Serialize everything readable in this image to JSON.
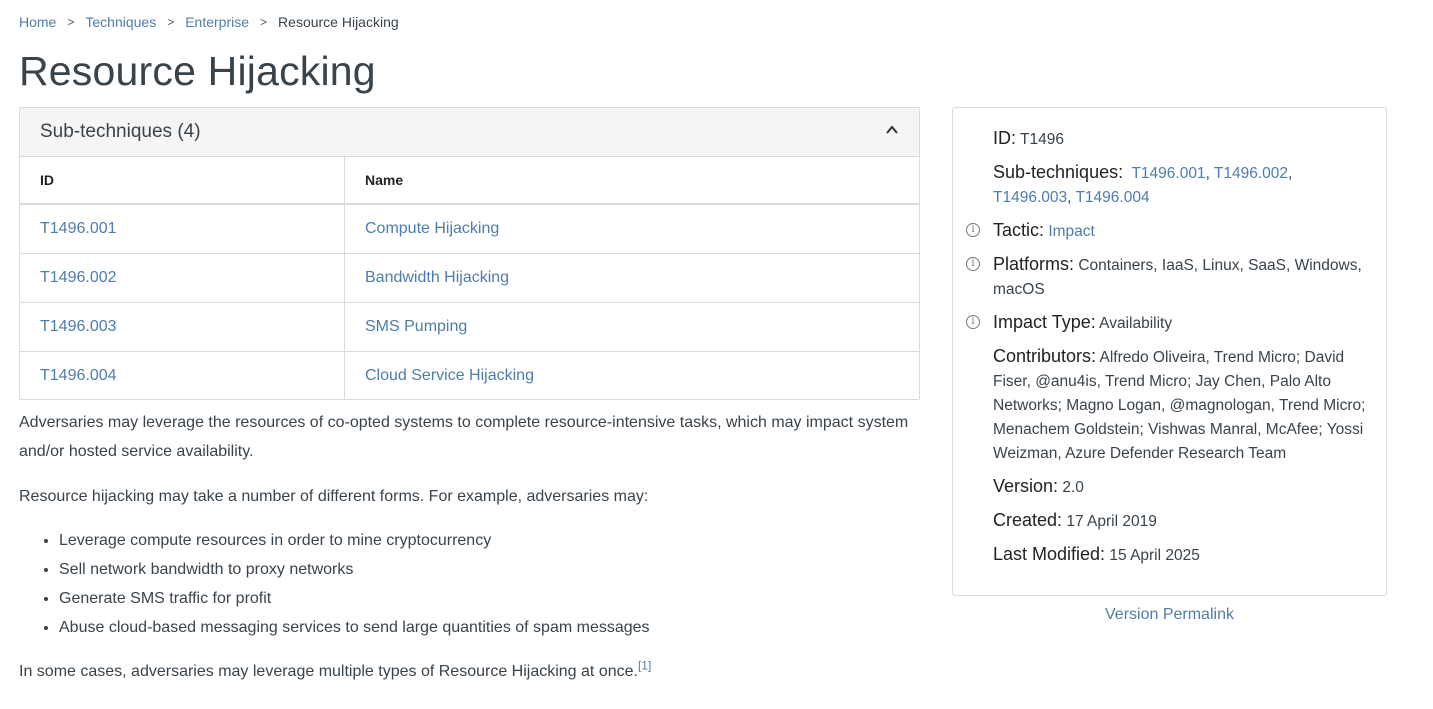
{
  "breadcrumb": {
    "items": [
      {
        "label": "Home"
      },
      {
        "label": "Techniques"
      },
      {
        "label": "Enterprise"
      }
    ],
    "current": "Resource Hijacking",
    "separator": ">"
  },
  "page": {
    "title": "Resource Hijacking"
  },
  "subtechniques": {
    "title": "Sub-techniques (4)",
    "columns": [
      "ID",
      "Name"
    ],
    "rows": [
      {
        "id": "T1496.001",
        "name": "Compute Hijacking"
      },
      {
        "id": "T1496.002",
        "name": "Bandwidth Hijacking"
      },
      {
        "id": "T1496.003",
        "name": "SMS Pumping"
      },
      {
        "id": "T1496.004",
        "name": "Cloud Service Hijacking"
      }
    ]
  },
  "description": {
    "p1": "Adversaries may leverage the resources of co-opted systems to complete resource-intensive tasks, which may impact system and/or hosted service availability.",
    "p2": "Resource hijacking may take a number of different forms. For example, adversaries may:",
    "bullets": [
      "Leverage compute resources in order to mine cryptocurrency",
      "Sell network bandwidth to proxy networks",
      "Generate SMS traffic for profit",
      "Abuse cloud-based messaging services to send large quantities of spam messages"
    ],
    "p3": "In some cases, adversaries may leverage multiple types of Resource Hijacking at once.",
    "p3_citation": "[1]"
  },
  "info": {
    "id_label": "ID:",
    "id_value": "T1496",
    "subtech_label": "Sub-techniques:",
    "subtech_links": [
      "T1496.001",
      "T1496.002",
      "T1496.003",
      "T1496.004"
    ],
    "tactic_label": "Tactic:",
    "tactic_value": "Impact",
    "platforms_label": "Platforms:",
    "platforms_value": "Containers, IaaS, Linux, SaaS, Windows, macOS",
    "impact_type_label": "Impact Type:",
    "impact_type_value": "Availability",
    "contributors_label": "Contributors:",
    "contributors_value": "Alfredo Oliveira, Trend Micro; David Fiser, @anu4is, Trend Micro; Jay Chen, Palo Alto Networks; Magno Logan, @magnologan, Trend Micro; Menachem Goldstein; Vishwas Manral, McAfee; Yossi Weizman, Azure Defender Research Team",
    "version_label": "Version:",
    "version_value": "2.0",
    "created_label": "Created:",
    "created_value": "17 April 2019",
    "modified_label": "Last Modified:",
    "modified_value": "15 April 2025",
    "info_icon_glyph": "i"
  },
  "permalink": {
    "label": "Version Permalink"
  },
  "colors": {
    "link": "#4f7cac",
    "text": "#39434c",
    "border": "#dadada",
    "header_bg": "#f5f5f5"
  },
  "icons": {
    "chevron": "chevron-up-icon",
    "info": "info-circle-icon"
  }
}
